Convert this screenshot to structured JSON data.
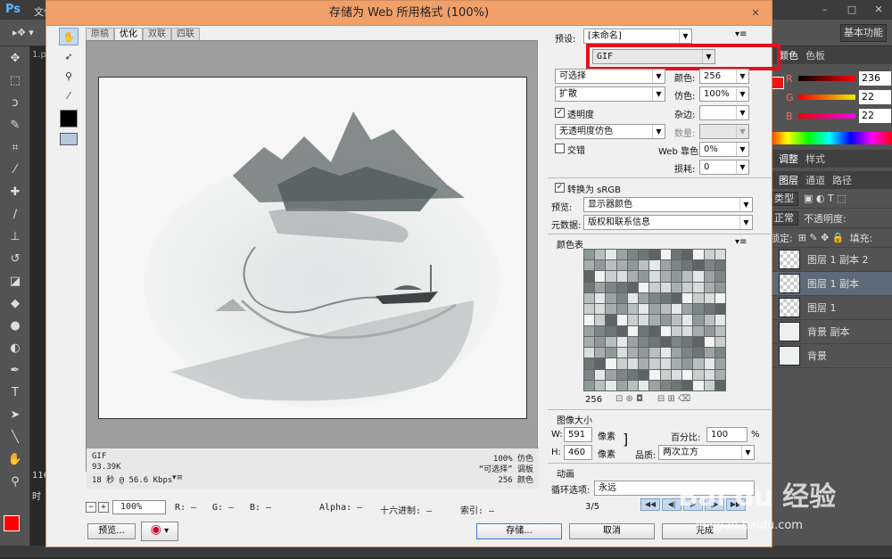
{
  "app": {
    "logo": "Ps",
    "menu_file": "文件",
    "workspace": "基本功能"
  },
  "document": {
    "tab": "1.p",
    "zoom": "116.",
    "timeline_label": "时",
    "loop_label": "永远"
  },
  "dialog": {
    "title": "存储为 Web 所用格式 (100%)",
    "view_tabs": [
      "原稿",
      "优化",
      "双联",
      "四联"
    ],
    "info": {
      "format": "GIF",
      "size": "93.39K",
      "speed": "18 秒 @ 56.6 Kbps",
      "dither": "100% 仿色",
      "palette": "“可选择” 调板",
      "colors": "256 颜色"
    },
    "status": {
      "zoom": "100%",
      "r": "R: —",
      "g": "G: —",
      "b": "B: —",
      "alpha": "Alpha: —",
      "hex": "十六进制: —",
      "index": "索引: —"
    },
    "buttons": {
      "preview": "预览...",
      "save": "存储...",
      "cancel": "取消",
      "done": "完成"
    },
    "settings": {
      "preset_label": "预设:",
      "preset_value": "[未命名]",
      "format": "GIF",
      "reduction": "可选择",
      "colors_label": "颜色:",
      "colors_value": "256",
      "dither_algo": "扩散",
      "dither_label": "仿色:",
      "dither_value": "100%",
      "transparency_label": "透明度",
      "matte_label": "杂边:",
      "transparency_dither": "无透明度仿色",
      "amount_label": "数量:",
      "interlaced_label": "交错",
      "websnap_label": "Web 靠色:",
      "websnap_value": "0%",
      "lossy_label": "损耗:",
      "lossy_value": "0",
      "srgb_label": "转换为 sRGB",
      "preview_label": "预览:",
      "preview_value": "显示器颜色",
      "metadata_label": "元数据:",
      "metadata_value": "版权和联系信息",
      "color_table_label": "颜色表",
      "color_count": "256",
      "image_size_label": "图像大小",
      "w_label": "W:",
      "w_value": "591",
      "h_label": "H:",
      "h_value": "460",
      "px_unit": "像素",
      "percent_label": "百分比:",
      "percent_value": "100",
      "percent_unit": "%",
      "quality_label": "品质:",
      "quality_value": "两次立方",
      "animation_label": "动画",
      "loop_label": "循环选项:",
      "loop_value": "永远",
      "frame": "3/5"
    }
  },
  "color_panel": {
    "tabs": [
      "颜色",
      "色板"
    ],
    "r": "236",
    "g": "22",
    "b": "22"
  },
  "layers_panel": {
    "tabs": [
      "调整",
      "样式"
    ],
    "tabs2": [
      "图层",
      "通道",
      "路径"
    ],
    "kind": "类型",
    "blend": "正常",
    "opacity_label": "不透明度:",
    "lock_label": "锁定:",
    "fill_label": "填充:",
    "layers": [
      {
        "name": "图层 1 副本 2",
        "active": false
      },
      {
        "name": "图层 1 副本",
        "active": true
      },
      {
        "name": "图层 1",
        "active": false
      },
      {
        "name": "背景 副本",
        "active": false
      },
      {
        "name": "背景",
        "active": false
      }
    ]
  },
  "watermark": {
    "brand": "Bai du 经验",
    "url": "jingyan.baidu.com"
  },
  "colors": {
    "highlight": "#e3101f",
    "titlebar": "#f0a068",
    "fg": "#ec1616"
  }
}
